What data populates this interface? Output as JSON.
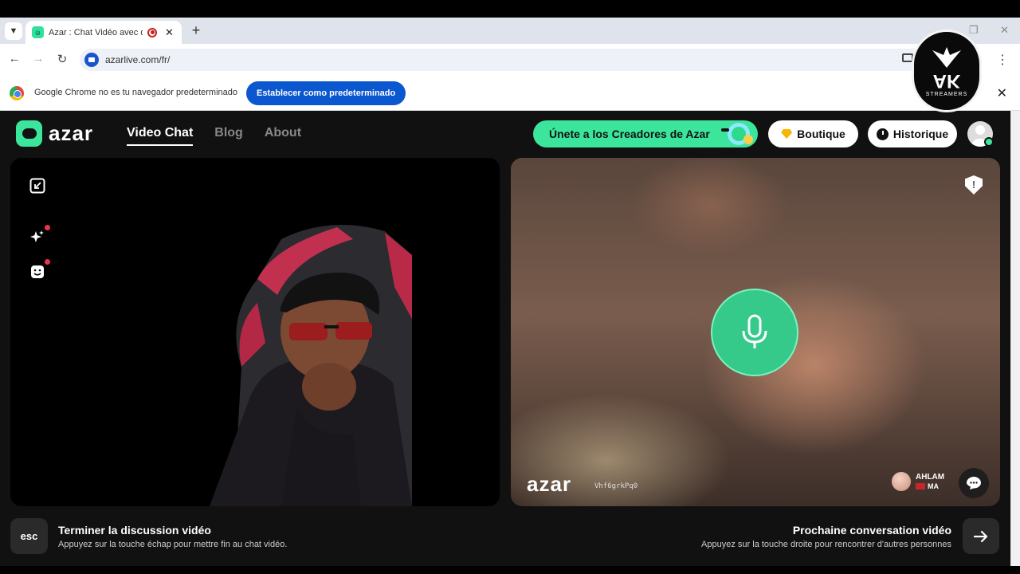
{
  "browser": {
    "tab_title": "Azar : Chat Vidéo avec de n",
    "new_tab_symbol": "+",
    "url": "azarlive.com/fr/",
    "infobar_text": "Google Chrome no es tu navegador predeterminado",
    "infobar_button": "Establecer como predeterminado"
  },
  "header": {
    "logo_text": "azar",
    "nav": [
      {
        "label": "Video Chat",
        "active": true
      },
      {
        "label": "Blog",
        "active": false
      },
      {
        "label": "About",
        "active": false
      }
    ],
    "creators_button": "Únete a los Creadores de Azar",
    "boutique_button": "Boutique",
    "historique_button": "Historique"
  },
  "watermark": {
    "main": "AK",
    "sub": "STREAMERS"
  },
  "remote_video": {
    "watermark_logo": "azar",
    "watermark_code": "Vhf6grkPq0",
    "user_name": "AHLAM",
    "user_country": "MA"
  },
  "bottom": {
    "esc_label": "esc",
    "end_title": "Terminer la discussion vidéo",
    "end_desc": "Appuyez sur la touche échap pour mettre fin au chat vidéo.",
    "next_title": "Prochaine conversation vidéo",
    "next_desc": "Appuyez sur la touche droite pour rencontrer d'autres personnes"
  },
  "colors": {
    "brand_green": "#3ce59c",
    "chrome_blue": "#0b57d0",
    "notification_red": "#e8344f"
  }
}
